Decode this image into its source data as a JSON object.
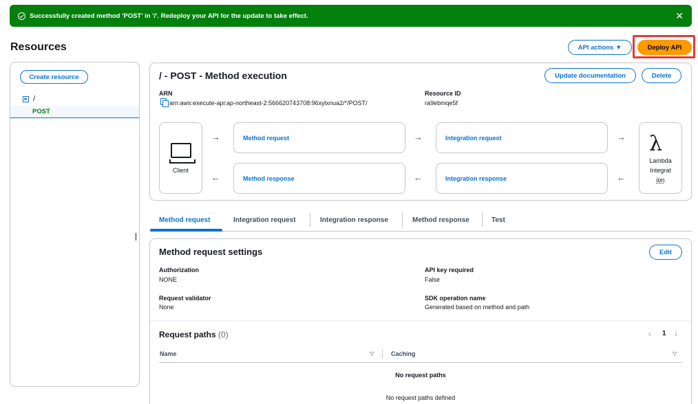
{
  "flash": {
    "message": "Successfully created method 'POST' in '/'. Redeploy your API for the update to take effect.",
    "close_glyph": "✕"
  },
  "page": {
    "title": "Resources"
  },
  "header_actions": {
    "api_actions": "API actions ▼",
    "deploy": "Deploy API"
  },
  "sidebar": {
    "create_resource": "Create resource",
    "root_path": "/",
    "selected_method": "POST"
  },
  "method_exec": {
    "title": "/ - POST - Method execution",
    "update_doc": "Update documentation",
    "delete": "Delete",
    "arn_label": "ARN",
    "arn_value": "arn:aws:execute-api:ap-northeast-2:566620743708:96xylxnua2/*/POST/",
    "resource_id_label": "Resource ID",
    "resource_id_value": "ra9ebmqe5f"
  },
  "flow": {
    "client": "Client",
    "method_request": "Method request",
    "integration_request": "Integration request",
    "method_response": "Method response",
    "integration_response": "Integration response",
    "lambda_l1": "Lambda",
    "lambda_l2": "Integrat",
    "lambda_l3": "ion",
    "arrow_right": "→",
    "arrow_left": "←"
  },
  "tabs": [
    "Method request",
    "Integration request",
    "Integration response",
    "Method response",
    "Test"
  ],
  "settings": {
    "title": "Method request settings",
    "edit": "Edit",
    "authorization_label": "Authorization",
    "authorization_value": "NONE",
    "api_key_label": "API key required",
    "api_key_value": "False",
    "validator_label": "Request validator",
    "validator_value": "None",
    "sdk_label": "SDK operation name",
    "sdk_value": "Generated based on method and path"
  },
  "request_paths": {
    "title": "Request paths",
    "count": "(0)",
    "page": "1",
    "prev": "‹",
    "next": "›",
    "col_name": "Name",
    "col_caching": "Caching",
    "sort_glyph": "▽",
    "empty_title": "No request paths",
    "empty_sub": "No request paths defined"
  }
}
